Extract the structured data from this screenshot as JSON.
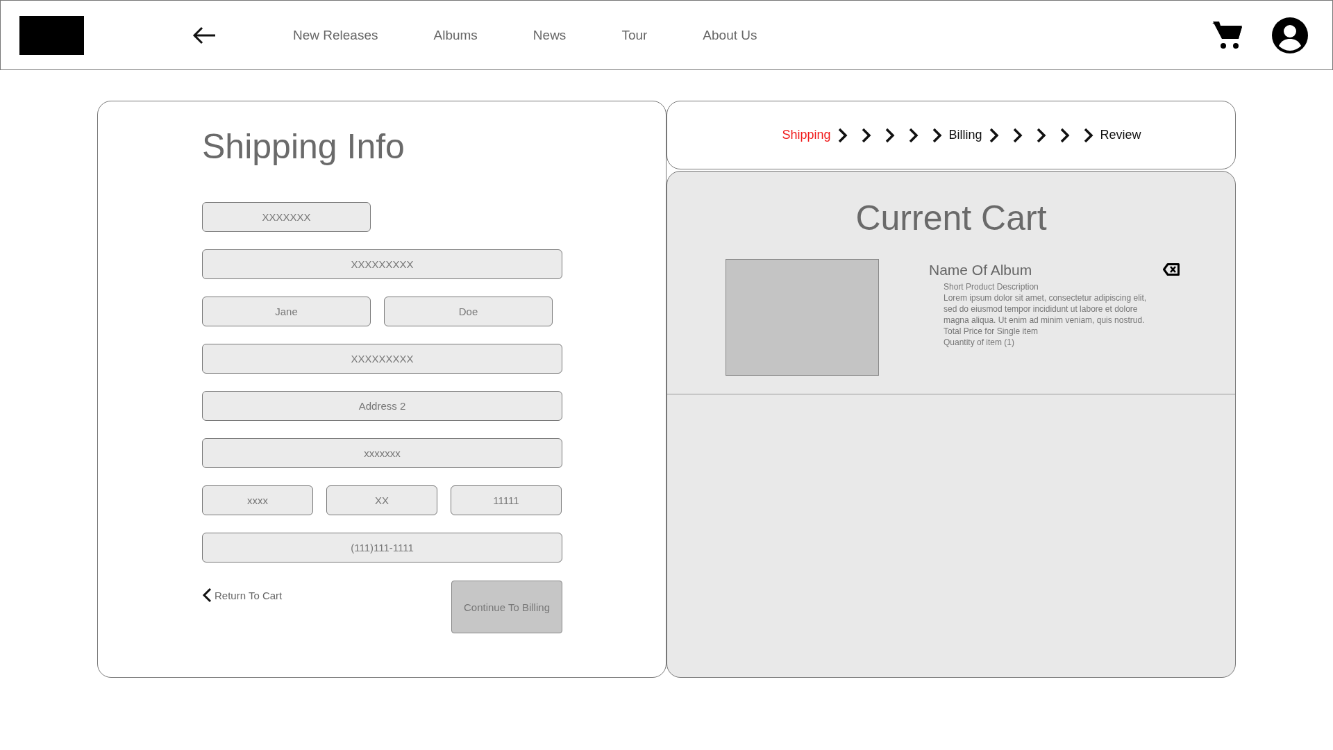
{
  "header": {
    "nav": [
      "New Releases",
      "Albums",
      "News",
      "Tour",
      "About Us"
    ]
  },
  "shipping": {
    "title": "Shipping Info",
    "fields": [
      {
        "value": "XXXXXXX",
        "kind": "half"
      },
      {
        "value": "XXXXXXXXX",
        "kind": "full"
      },
      {
        "value": "Jane",
        "kind": "half"
      },
      {
        "value": "Doe",
        "kind": "half"
      },
      {
        "value": "XXXXXXXXX",
        "kind": "full"
      },
      {
        "value": "Address 2",
        "kind": "full"
      },
      {
        "value": "xxxxxxx",
        "kind": "full"
      },
      {
        "value": "xxxx",
        "kind": "third"
      },
      {
        "value": "XX",
        "kind": "third"
      },
      {
        "value": "11111",
        "kind": "third"
      },
      {
        "value": "(111)111-1111",
        "kind": "full"
      }
    ],
    "back_link": "Return To Cart",
    "continue_button": {
      "label": "Continue To Billing",
      "disabled": true
    }
  },
  "steps": [
    {
      "kind": "label",
      "label": "Shipping",
      "selected": true
    },
    {
      "kind": "chevron"
    },
    {
      "kind": "chevron"
    },
    {
      "kind": "chevron"
    },
    {
      "kind": "chevron"
    },
    {
      "kind": "chevron"
    },
    {
      "kind": "label",
      "label": "Billing",
      "selected": false
    },
    {
      "kind": "chevron"
    },
    {
      "kind": "chevron"
    },
    {
      "kind": "chevron"
    },
    {
      "kind": "chevron"
    },
    {
      "kind": "chevron"
    },
    {
      "kind": "label",
      "label": "Review",
      "selected": false
    }
  ],
  "cart": {
    "title": "Current Cart",
    "items": [
      {
        "name": "Name Of Album",
        "details": [
          "Short Product Description",
          "Lorem ipsum dolor sit amet, consectetur adipiscing elit,",
          "sed do eiusmod tempor incididunt ut labore et dolore",
          "magna aliqua. Ut enim ad minim veniam, quis nostrud.",
          "Total Price for Single item",
          "Quantity of item (1)"
        ]
      }
    ]
  }
}
